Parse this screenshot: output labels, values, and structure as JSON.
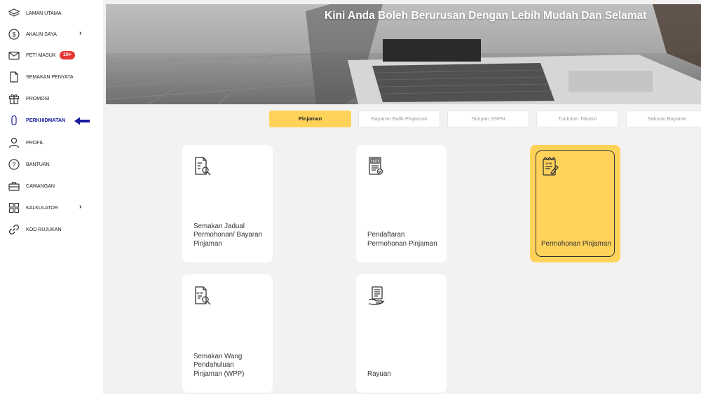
{
  "sidebar": {
    "items": [
      {
        "label": "LAMAN UTAMA",
        "icon": "layers-icon"
      },
      {
        "label": "AKAUN SAYA",
        "icon": "dollar-circle-icon",
        "chevron": "›"
      },
      {
        "label": "PETI MASUK",
        "icon": "mail-icon",
        "badge": "10+"
      },
      {
        "label": "SEMAKAN PENYATA",
        "icon": "document-icon"
      },
      {
        "label": "PROMOSI",
        "icon": "gift-icon"
      },
      {
        "label": "PERKHIDMATAN",
        "icon": "phone-icon",
        "active": true
      },
      {
        "label": "PROFIL",
        "icon": "user-icon"
      },
      {
        "label": "BANTUAN",
        "icon": "help-icon"
      },
      {
        "label": "CAWANGAN",
        "icon": "briefcase-icon"
      },
      {
        "label": "KALKULATOR",
        "icon": "calculator-icon",
        "chevron": "›"
      },
      {
        "label": "KOD RUJUKAN",
        "icon": "link-icon"
      }
    ]
  },
  "banner": {
    "title": "Kini Anda Boleh Berurusan Dengan Lebih Mudah Dan Selamat"
  },
  "tabs": [
    {
      "label": "Pinjaman",
      "active": true
    },
    {
      "label": "Bayaran Balik Pinjaman"
    },
    {
      "label": "Simpan SSPN"
    },
    {
      "label": "Tuntutan Takaful"
    },
    {
      "label": "Saluran Bayaran"
    }
  ],
  "cards": [
    {
      "label": "Semakan Jadual Permohonan/ Bayaran Pinjaman",
      "icon": "document-search-icon"
    },
    {
      "label": "Pendaftaran Permohonan Pinjaman",
      "icon": "pin-document-icon"
    },
    {
      "label": "Permohonan Pinjaman",
      "icon": "loan-form-icon",
      "highlight": true
    },
    {
      "label": "Semakan Wang Pendahuluan Pinjaman (WPP)",
      "icon": "wpp-search-icon"
    },
    {
      "label": "Rayuan",
      "icon": "appeal-document-icon"
    }
  ],
  "colors": {
    "accent_yellow": "#ffd25a",
    "highlight_blue": "#1a1a9e",
    "badge_red": "#e53935"
  }
}
